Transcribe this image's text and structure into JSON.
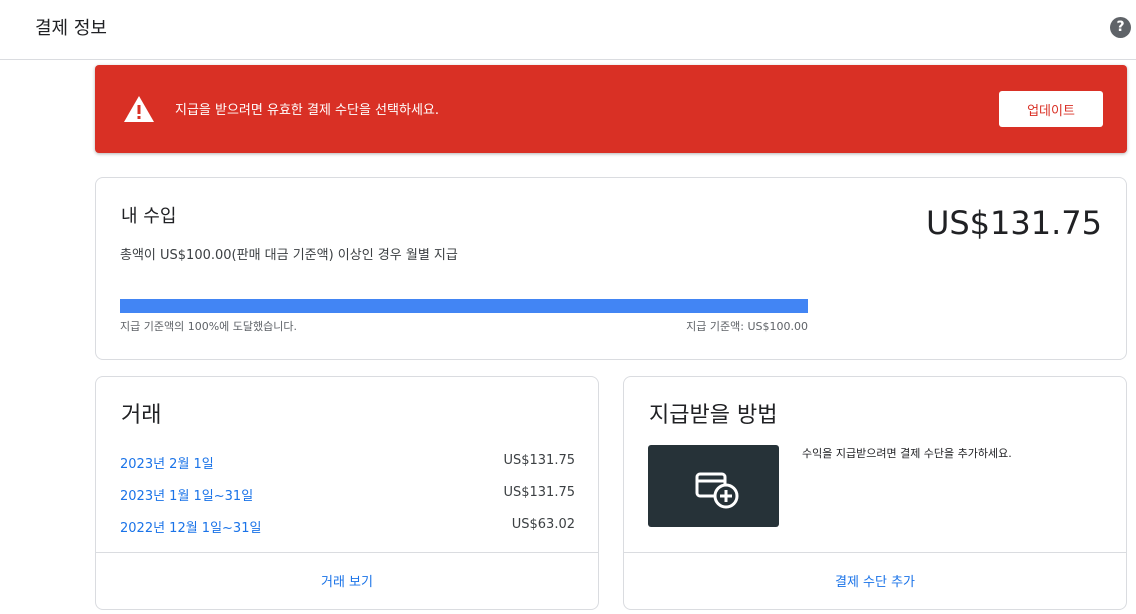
{
  "header": {
    "title": "결제 정보",
    "help_icon": "help-icon"
  },
  "alert": {
    "icon": "warning-icon",
    "message": "지급을 받으려면 유효한 결제 수단을 선택하세요.",
    "button_label": "업데이트"
  },
  "earnings": {
    "title": "내 수입",
    "description": "총액이 US$100.00(판매 대금 기준액) 이상인 경우 월별 지급",
    "amount": "US$131.75",
    "progress_percent": 100,
    "progress_left_text": "지급 기준액의 100%에 도달했습니다.",
    "progress_right_text": "지급 기준액: US$100.00"
  },
  "transactions": {
    "title": "거래",
    "rows": [
      {
        "date": "2023년 2월 1일",
        "amount": "US$131.75"
      },
      {
        "date": "2023년 1월 1일~31일",
        "amount": "US$131.75"
      },
      {
        "date": "2022년 12월 1일~31일",
        "amount": "US$63.02"
      }
    ],
    "view_link": "거래 보기"
  },
  "payment_method": {
    "title": "지급받을 방법",
    "image_icon": "add-card-icon",
    "text": "수익을 지급받으려면 결제 수단을 추가하세요.",
    "add_link": "결제 수단 추가"
  },
  "colors": {
    "alert": "#d93025",
    "link": "#1a73e8",
    "progress": "#4285f4"
  }
}
